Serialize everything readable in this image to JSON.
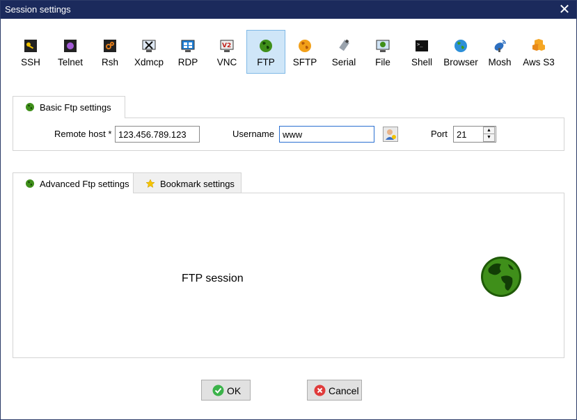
{
  "window": {
    "title": "Session settings",
    "close_glyph": "✕"
  },
  "protocols": [
    {
      "label": "SSH",
      "icon": "key-icon"
    },
    {
      "label": "Telnet",
      "icon": "telnet-icon"
    },
    {
      "label": "Rsh",
      "icon": "rsh-icon"
    },
    {
      "label": "Xdmcp",
      "icon": "xdmcp-icon"
    },
    {
      "label": "RDP",
      "icon": "rdp-icon"
    },
    {
      "label": "VNC",
      "icon": "vnc-icon"
    },
    {
      "label": "FTP",
      "icon": "globe-icon",
      "active": true
    },
    {
      "label": "SFTP",
      "icon": "sftp-icon"
    },
    {
      "label": "Serial",
      "icon": "serial-icon"
    },
    {
      "label": "File",
      "icon": "file-icon"
    },
    {
      "label": "Shell",
      "icon": "shell-icon"
    },
    {
      "label": "Browser",
      "icon": "browser-icon"
    },
    {
      "label": "Mosh",
      "icon": "satellite-icon"
    },
    {
      "label": "Aws S3",
      "icon": "aws-icon"
    }
  ],
  "basic_tab": {
    "label": "Basic Ftp settings"
  },
  "fields": {
    "remote_host_label": "Remote host *",
    "remote_host_value": "123.456.789.123",
    "username_label": "Username",
    "username_value": "www",
    "port_label": "Port",
    "port_value": "21"
  },
  "lower_tabs": [
    {
      "label": "Advanced Ftp settings",
      "icon": "globe-icon"
    },
    {
      "label": "Bookmark settings",
      "icon": "star-icon"
    }
  ],
  "content": {
    "text": "FTP session"
  },
  "buttons": {
    "ok": "OK",
    "cancel": "Cancel"
  },
  "colors": {
    "titlebar": "#1b2a5c",
    "active_tab": "#cfe6f8",
    "globe_green": "#3f8f1a"
  }
}
